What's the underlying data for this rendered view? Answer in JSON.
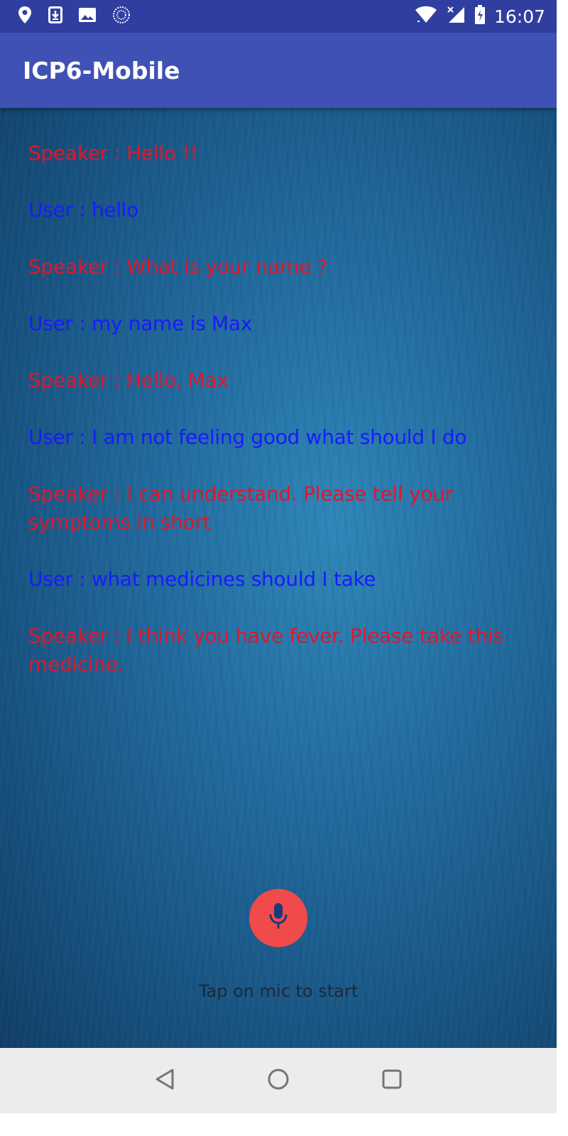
{
  "status_bar": {
    "time": "16:07",
    "icons_left": [
      "location-icon",
      "download-icon",
      "image-icon",
      "sync-icon"
    ],
    "icons_right": [
      "wifi-icon",
      "signal-icon",
      "battery-icon"
    ]
  },
  "app_bar": {
    "title": "ICP6-Mobile"
  },
  "conversation": [
    {
      "role": "speaker",
      "text": "Speaker : Hello !!"
    },
    {
      "role": "user",
      "text": "User : hello"
    },
    {
      "role": "speaker",
      "text": "Speaker : What is your name ?"
    },
    {
      "role": "user",
      "text": "User : my name is Max"
    },
    {
      "role": "speaker",
      "text": "Speaker : Hello, Max"
    },
    {
      "role": "user",
      "text": "User : I am not feeling good what should I do"
    },
    {
      "role": "speaker",
      "text": "Speaker : I can understand. Please tell your symptoms in short"
    },
    {
      "role": "user",
      "text": "User : what medicines should I take"
    },
    {
      "role": "speaker",
      "text": "Speaker : I think you have fever. Please take this medicine."
    }
  ],
  "mic": {
    "icon": "microphone-icon"
  },
  "hint": "Tap on mic to start",
  "nav_bar": {
    "buttons": [
      "back-icon",
      "home-icon",
      "recents-icon"
    ]
  },
  "colors": {
    "status_bar": "#303f9f",
    "app_bar": "#3f51b5",
    "speaker_text": "#e3162a",
    "user_text": "#1a1aff",
    "mic_button": "#f14a4a",
    "nav_bar": "#ececec"
  }
}
